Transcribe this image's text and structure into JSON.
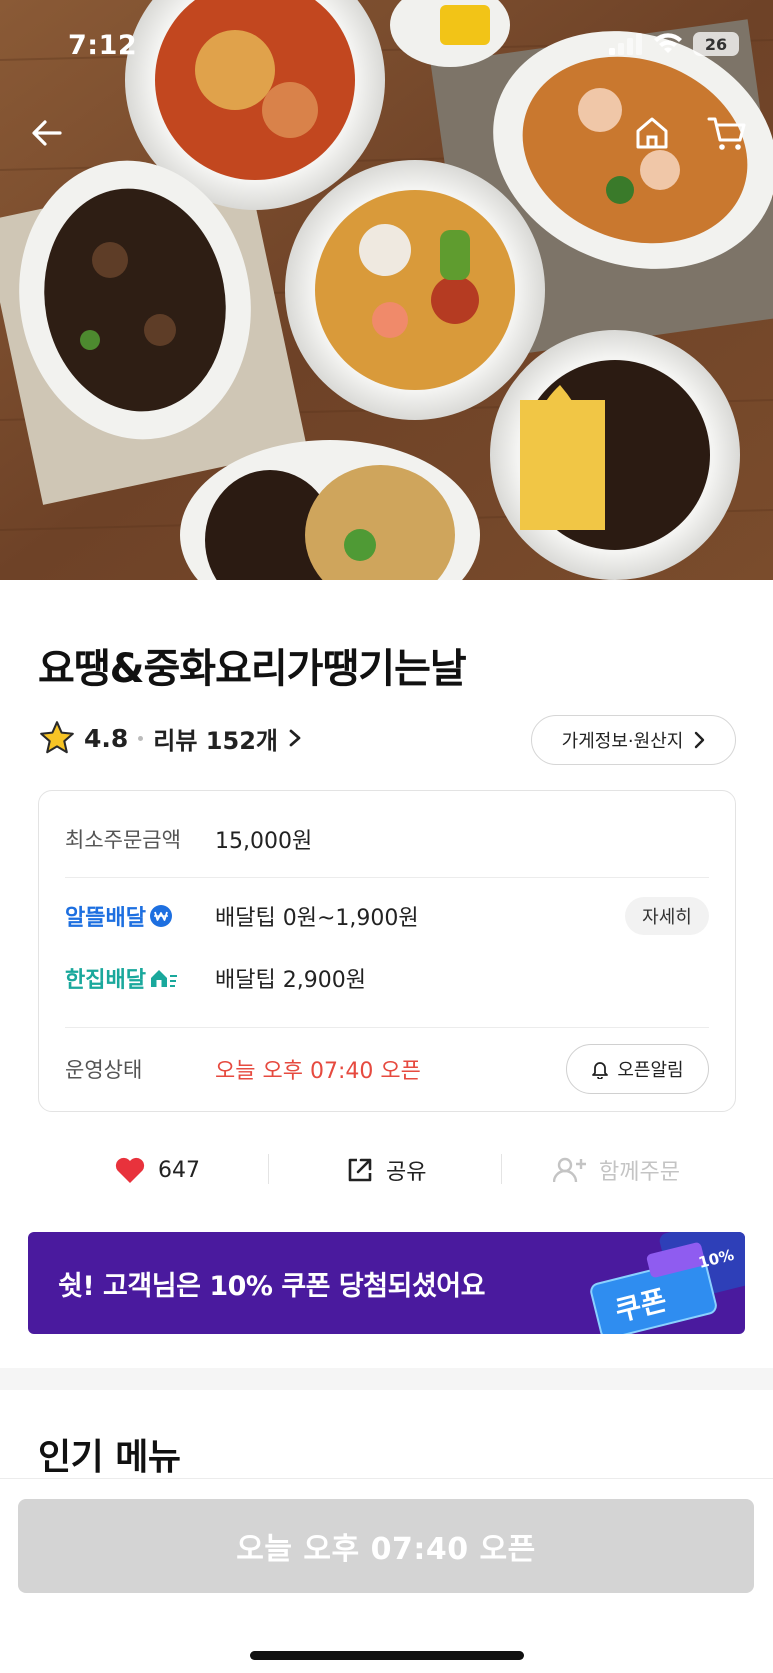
{
  "status_bar": {
    "time": "7:12",
    "battery": "26"
  },
  "nav": {
    "back_icon": "back-arrow-icon",
    "home_icon": "home-icon",
    "cart_icon": "cart-icon"
  },
  "store": {
    "name": "요땡&중화요리가땡기는날",
    "rating": "4.8",
    "reviews": "리뷰 152개",
    "info_button": "가게정보·원산지"
  },
  "info": {
    "min_order_label": "최소주문금액",
    "min_order_value": "15,000원",
    "alddeul_label": "알뜰배달",
    "alddeul_value": "배달팁 0원~1,900원",
    "detail_button": "자세히",
    "hanjip_label": "한집배달",
    "hanjip_value": "배달팁 2,900원",
    "status_label": "운영상태",
    "status_value": "오늘 오후 07:40 오픈",
    "alert_button": "오픈알림"
  },
  "actions": {
    "likes": "647",
    "share": "공유",
    "group_order": "함께주문"
  },
  "coupon": {
    "text": "쉿! 고객님은 10% 쿠폰 당첨되셨어요",
    "badge_percent": "10%",
    "badge_label": "쿠폰"
  },
  "menu_section": {
    "title": "인기 메뉴"
  },
  "cta": {
    "label": "오늘 오후 07:40 오픈"
  },
  "colors": {
    "accent_blue": "#1d6fe0",
    "accent_teal": "#1aa89c",
    "open_red": "#e64a3f",
    "coupon_bg": "#4a1a9e",
    "cta_disabled": "#d4d4d4"
  }
}
